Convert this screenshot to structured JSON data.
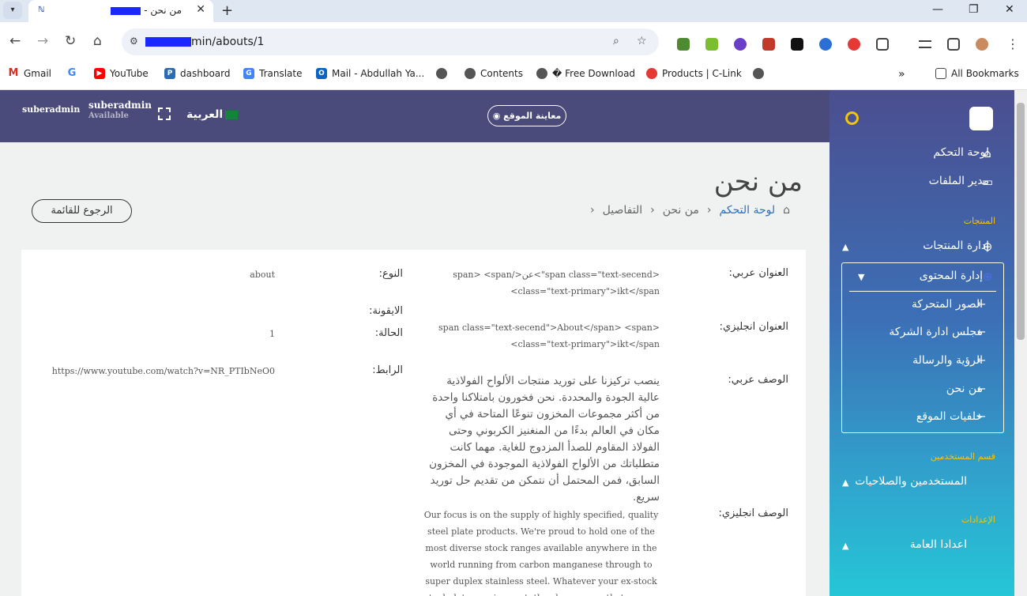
{
  "browser": {
    "tab_title": "من نحن - ",
    "url": "min/abouts/1",
    "bookmarks": [
      "Gmail",
      "YouTube",
      "dashboard",
      "Translate",
      "Mail - Abdullah Ya...",
      "Contents",
      "� Free Download",
      "Products | C-Link"
    ],
    "all_bookmarks": "All Bookmarks",
    "colors": {
      "tab_bar": "#dfe7f3",
      "redaction": "#1a28ff"
    }
  },
  "header": {
    "user_name": "suberadmin",
    "user_status": "Available",
    "avatar_alt": "suberadmin",
    "language": "العربية",
    "preview_label": "معاينة الموقع",
    "color": "#4a4a7b"
  },
  "page": {
    "title": "من نحن",
    "breadcrumb": {
      "home": "لوحة التحكم",
      "current": "من نحن",
      "details": "التفاصيل"
    },
    "back_label": "الرجوع للقائمة"
  },
  "details": {
    "title_ar_label": "العنوان عربي:",
    "title_ar_value_1": "span> <span/>عن<\"span class=\"text-secend>",
    "title_ar_value_2": "<class=\"text-primary\">ikt</span",
    "title_en_label": "العنوان انجليزي:",
    "title_en_value_1": "span class=\"text-secend\">About</span> <span>",
    "title_en_value_2": "<class=\"text-primary\">ikt</span",
    "desc_ar_label": "الوصف عربي:",
    "desc_ar_value": "ينصب تركيزنا على توريد منتجات الألواح الفولاذية عالية الجودة والمحددة. نحن فخورون بامتلاكنا واحدة من أكثر مجموعات المخزون تنوعًا المتاحة في أي مكان في العالم بدءًا من المنغنيز الكربوني وحتى الفولاذ المقاوم للصدأ المزدوج للغاية. مهما كانت متطلباتك من الألواح الفولاذية الموجودة في المخزون السابق، فمن المحتمل أن نتمكن من تقديم حل توريد سريع.",
    "desc_en_label": "الوصف انجليزي:",
    "desc_en_value": "Our focus is on the supply of highly specified, quality steel plate products. We're proud to hold one of the most diverse stock ranges available anywhere in the world running from carbon manganese through to super duplex stainless steel. Whatever your ex-stock steel plate requirement, the chances are that we can offer a",
    "type_label": "النوع:",
    "type_value": "about",
    "icon_label": "الايقونة:",
    "status_label": "الحالة:",
    "status_value": "1",
    "link_label": "الرابط:",
    "link_value": "https://www.youtube.com/watch?v=NR_PTIbNeO0"
  },
  "sidebar": {
    "dashboard": "لوحة التحكم",
    "file_manager": "مدير الملفات",
    "section_products": "المنتجات",
    "products_management": "إدارة المنتجات",
    "content_management": "إدارة المحتوى",
    "sub_items": [
      "الصور المتحركة",
      "مجلس ادارة الشركة",
      "الرؤية والرسالة",
      "من نحن",
      "خلفيات الموقع"
    ],
    "section_users": "قسم المستخدمين",
    "users_permissions": "المستخدمين والصلاحيات",
    "section_settings": "الإعدادات",
    "general_settings": "اعدادا العامة",
    "accent": "#f0c419"
  }
}
